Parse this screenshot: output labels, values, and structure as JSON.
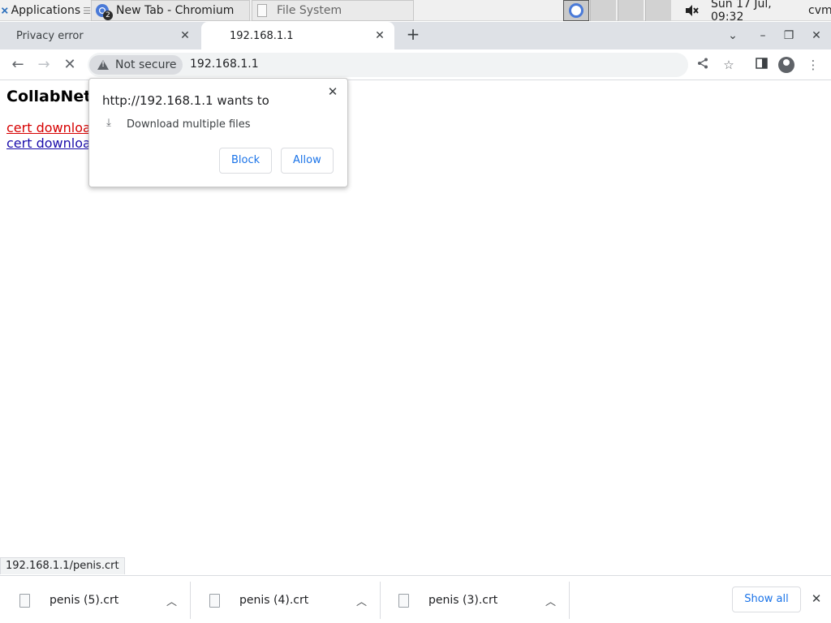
{
  "taskbar": {
    "apps_label": "Applications",
    "apps_suffix": "☰",
    "window_chromium": "New Tab - Chromium",
    "window_chromium_count": "2",
    "window_files": "File System",
    "clock": "Sun 17 Jul, 09:32",
    "user": "cvm"
  },
  "tabs": [
    {
      "title": "Privacy error"
    },
    {
      "title": "192.168.1.1"
    }
  ],
  "toolbar": {
    "security_chip": "Not secure",
    "url": "192.168.1.1"
  },
  "page": {
    "title": "CollabNet",
    "links": [
      "cert download",
      "cert download"
    ],
    "status_url": "192.168.1.1/penis.crt"
  },
  "popup": {
    "title": "http://192.168.1.1 wants to",
    "permission": "Download multiple files",
    "block_label": "Block",
    "allow_label": "Allow"
  },
  "downloads": {
    "items": [
      {
        "filename": "penis (5).crt"
      },
      {
        "filename": "penis (4).crt"
      },
      {
        "filename": "penis (3).crt"
      }
    ],
    "show_all_label": "Show all"
  }
}
